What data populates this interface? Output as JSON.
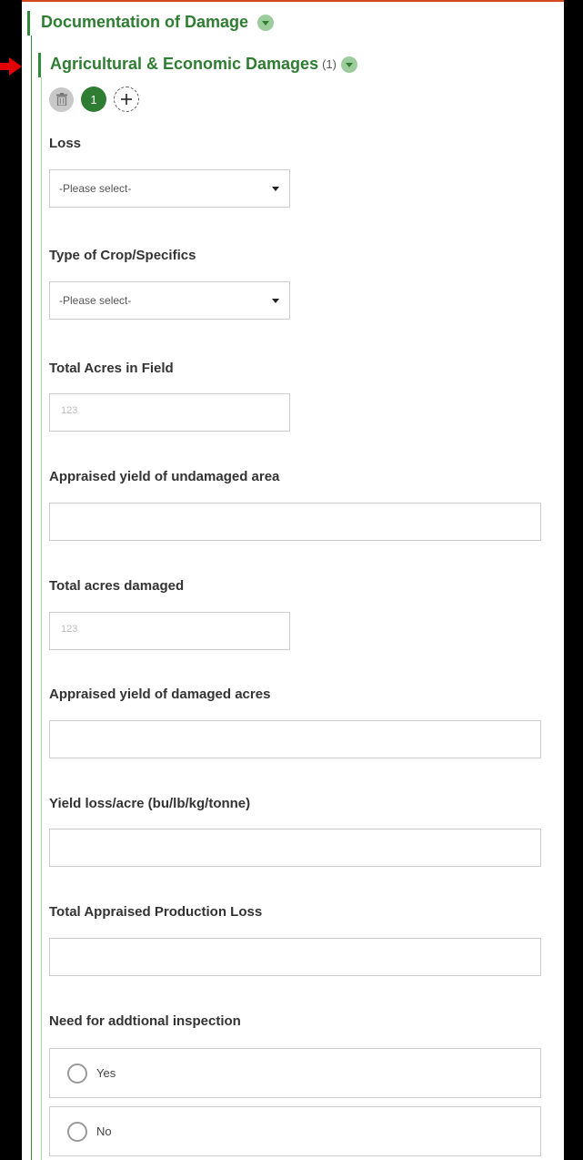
{
  "section": {
    "title": "Documentation of Damage"
  },
  "subsection": {
    "title": "Agricultural & Economic Damages",
    "count": "(1)",
    "record_number": "1"
  },
  "fields": {
    "loss": {
      "label": "Loss",
      "value": "-Please select-"
    },
    "crop": {
      "label": "Type of Crop/Specifics",
      "value": "-Please select-"
    },
    "total_acres": {
      "label": "Total Acres in Field",
      "placeholder_icon": "123-number-icon",
      "placeholder_text": "123"
    },
    "yield_undamaged": {
      "label": "Appraised yield of undamaged area",
      "value": ""
    },
    "acres_damaged": {
      "label": "Total acres damaged",
      "placeholder_icon": "123-number-icon",
      "placeholder_text": "123"
    },
    "yield_damaged": {
      "label": "Appraised yield of damaged acres",
      "value": ""
    },
    "yield_loss": {
      "label": "Yield loss/acre (bu/lb/kg/tonne)",
      "value": ""
    },
    "production_loss": {
      "label": "Total Appraised Production Loss",
      "value": ""
    },
    "inspection": {
      "label": "Need for addtional inspection",
      "options": [
        "Yes",
        "No"
      ]
    }
  },
  "colors": {
    "accent": "#2e7d32",
    "top_border": "#d24a1e",
    "pointer_arrow": "#e00000"
  }
}
